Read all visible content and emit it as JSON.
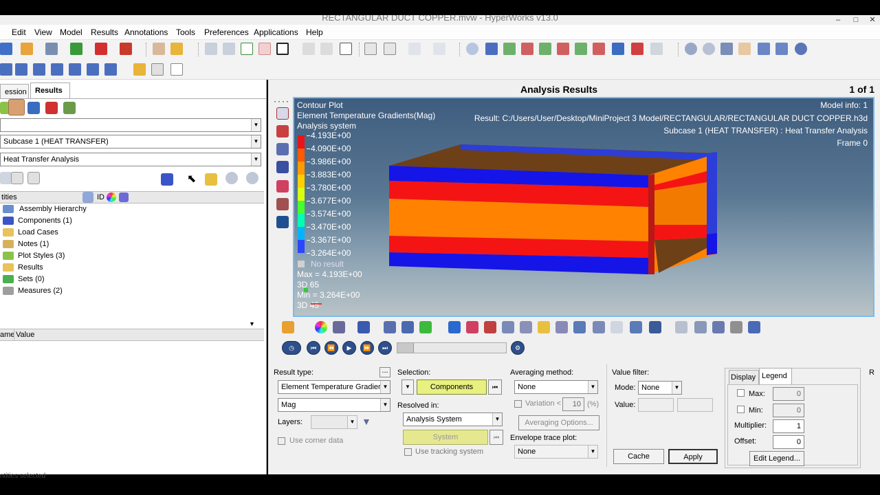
{
  "window": {
    "title": "RECTANGULAR DUCT COPPER.mvw - HyperWorks v13.0",
    "minimize": "–",
    "maximize": "□",
    "close": "✕"
  },
  "menu": [
    "Edit",
    "View",
    "Model",
    "Results",
    "Annotations",
    "Tools",
    "Preferences",
    "Applications",
    "Help"
  ],
  "toolbar_icons": [
    "open-icon",
    "save-icon",
    "import-icon",
    "export-icon",
    "ppt-icon",
    "user-icon",
    "print-icon",
    "undo-icon",
    "redo-icon",
    "add-page-icon",
    "delete-page-icon",
    "page-layout-icon",
    "capture-icon",
    "cut-icon",
    "paste-icon",
    "zoom-icon",
    "nav-icon",
    "axes-icon",
    "pan-icon",
    "rotate-icon"
  ],
  "left_panel": {
    "tabs": [
      "ession",
      "Results"
    ],
    "dropdown_blank": "",
    "subcase": "Subcase 1 (HEAT TRANSFER)",
    "analysis": "Heat Transfer Analysis",
    "entities_header": "tities",
    "id_header": "ID",
    "tree": [
      {
        "label": "Assembly Hierarchy",
        "color": "#6a8fd0"
      },
      {
        "label": "Components (1)",
        "color": "#3b55c8"
      },
      {
        "label": "Load Cases",
        "color": "#e8c25a"
      },
      {
        "label": "Notes (1)",
        "color": "#d7b15a"
      },
      {
        "label": "Plot Styles (3)",
        "color": "#8bc34a"
      },
      {
        "label": "Results",
        "color": "#e8c25a"
      },
      {
        "label": "Sets  (0)",
        "color": "#4caf50"
      },
      {
        "label": "Measures (2)",
        "color": "#9e9e9e"
      }
    ],
    "prop_name_header": "ame",
    "prop_value_header": "Value",
    "status": "ntities selected"
  },
  "header": {
    "title": "Analysis Results",
    "page": "1 of 1"
  },
  "viewport": {
    "plot_title": "Contour Plot",
    "result_name": "Element Temperature Gradients(Mag)",
    "system": "Analysis system",
    "legend_values": [
      "4.193E+00",
      "4.090E+00",
      "3.986E+00",
      "3.883E+00",
      "3.780E+00",
      "3.677E+00",
      "3.574E+00",
      "3.470E+00",
      "3.367E+00",
      "3.264E+00"
    ],
    "legend_colors": [
      "#e8141a",
      "#ff5a00",
      "#ff9a00",
      "#ffd000",
      "#d6ff10",
      "#46ff30",
      "#00ffb4",
      "#00b4ff",
      "#2a46ff",
      "#0000c8"
    ],
    "no_result": "No result",
    "max_label": "Max = 4.193E+00",
    "max_elem": "3D 65",
    "min_label": "Min = 3.264E+00",
    "min_elem": "3D 45",
    "model_info": "Model info: 1",
    "result_path": "Result:  C:/Users/User/Desktop/MiniProject 3 Model/RECTANGULAR/RECTANGULAR DUCT COPPER.h3d",
    "subcase_info": "Subcase 1 (HEAT TRANSFER) : Heat Transfer Analysis",
    "frame": "Frame 0"
  },
  "bottom": {
    "result_type_label": "Result type:",
    "result_type": "Element Temperature Gradients",
    "component": "Mag",
    "layers_label": "Layers:",
    "corner_data": "Use corner data",
    "selection_label": "Selection:",
    "components_btn": "Components",
    "resolved_label": "Resolved in:",
    "resolved": "Analysis System",
    "system_btn": "System",
    "tracking": "Use tracking system",
    "averaging_label": "Averaging method:",
    "averaging": "None",
    "variation_label": "Variation <",
    "variation_value": "10",
    "variation_unit": "(%)",
    "averaging_options": "Averaging Options...",
    "envelope_label": "Envelope trace plot:",
    "envelope": "None",
    "value_filter_label": "Value filter:",
    "mode_label": "Mode:",
    "mode": "None",
    "value_label": "Value:",
    "cache_btn": "Cache",
    "apply_btn": "Apply",
    "display_tab": "Display",
    "legend_tab": "Legend",
    "max_label": "Max:",
    "max_value": "0",
    "min_label": "Min:",
    "min_value": "0",
    "multiplier_label": "Multiplier:",
    "multiplier_value": "1",
    "offset_label": "Offset:",
    "offset_value": "0",
    "edit_legend": "Edit Legend...",
    "cut_label": "R"
  }
}
